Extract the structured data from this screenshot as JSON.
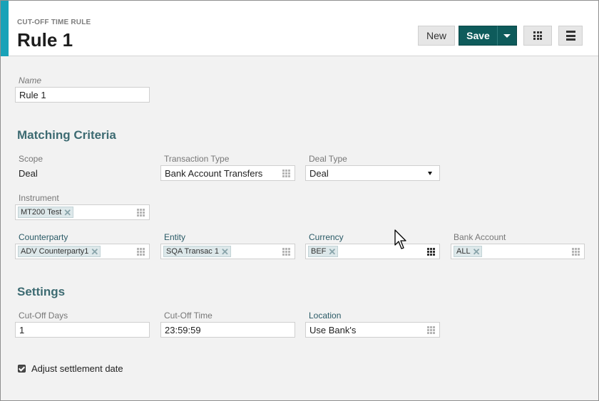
{
  "header": {
    "subtitle": "CUT-OFF TIME RULE",
    "title": "Rule 1",
    "buttons": {
      "new": "New",
      "save": "Save"
    }
  },
  "name_field": {
    "label": "Name",
    "value": "Rule 1"
  },
  "matching": {
    "title": "Matching Criteria",
    "scope": {
      "label": "Scope",
      "value": "Deal"
    },
    "transaction_type": {
      "label": "Transaction Type",
      "value": "Bank Account Transfers"
    },
    "deal_type": {
      "label": "Deal Type",
      "value": "Deal"
    },
    "instrument": {
      "label": "Instrument",
      "tag": "MT200 Test"
    },
    "counterparty": {
      "label": "Counterparty",
      "tag": "ADV Counterparty1"
    },
    "entity": {
      "label": "Entity",
      "tag": "SQA Transac 1"
    },
    "currency": {
      "label": "Currency",
      "tag": "BEF"
    },
    "bank_account": {
      "label": "Bank Account",
      "tag": "ALL"
    }
  },
  "settings": {
    "title": "Settings",
    "cutoff_days": {
      "label": "Cut-Off Days",
      "value": "1"
    },
    "cutoff_time": {
      "label": "Cut-Off Time",
      "value": "23:59:59"
    },
    "location": {
      "label": "Location",
      "value": "Use Bank's"
    },
    "adjust": {
      "label": "Adjust settlement date",
      "checked": true
    }
  },
  "colors": {
    "accent": "#18a2b8",
    "save_button": "#0e5b5b",
    "section_title": "#3d6b72"
  }
}
